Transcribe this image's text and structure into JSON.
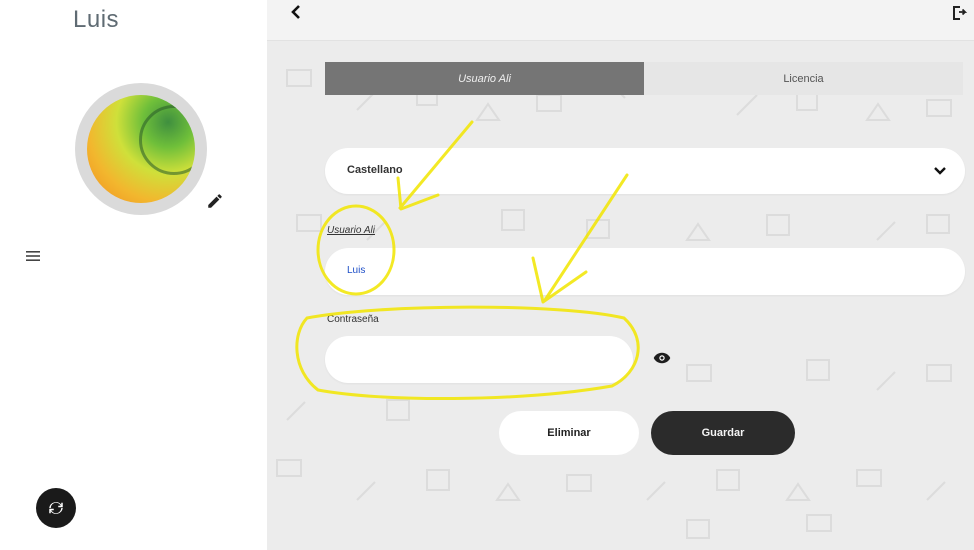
{
  "user": {
    "name": "Luis"
  },
  "tabs": [
    {
      "label": "Usuario Ali",
      "active": true
    },
    {
      "label": "Licencia",
      "active": false
    }
  ],
  "language": {
    "value": "Castellano"
  },
  "form": {
    "user_label": "Usuario Ali",
    "user_value": "Luis",
    "password_label": "Contraseña"
  },
  "buttons": {
    "delete_label": "Eliminar",
    "save_label": "Guardar"
  },
  "colors": {
    "accent_dark": "#2b2b2b",
    "tab_active": "#757575",
    "annotation": "#f2e600",
    "link_blue": "#1d4ec7"
  },
  "icons": {
    "back": "back-chevron-icon",
    "logout": "logout-icon",
    "edit": "pencil-icon",
    "menu": "hamburger-menu-icon",
    "sync": "sync-icon",
    "dropdown": "chevron-down-icon",
    "visibility": "eye-icon"
  }
}
